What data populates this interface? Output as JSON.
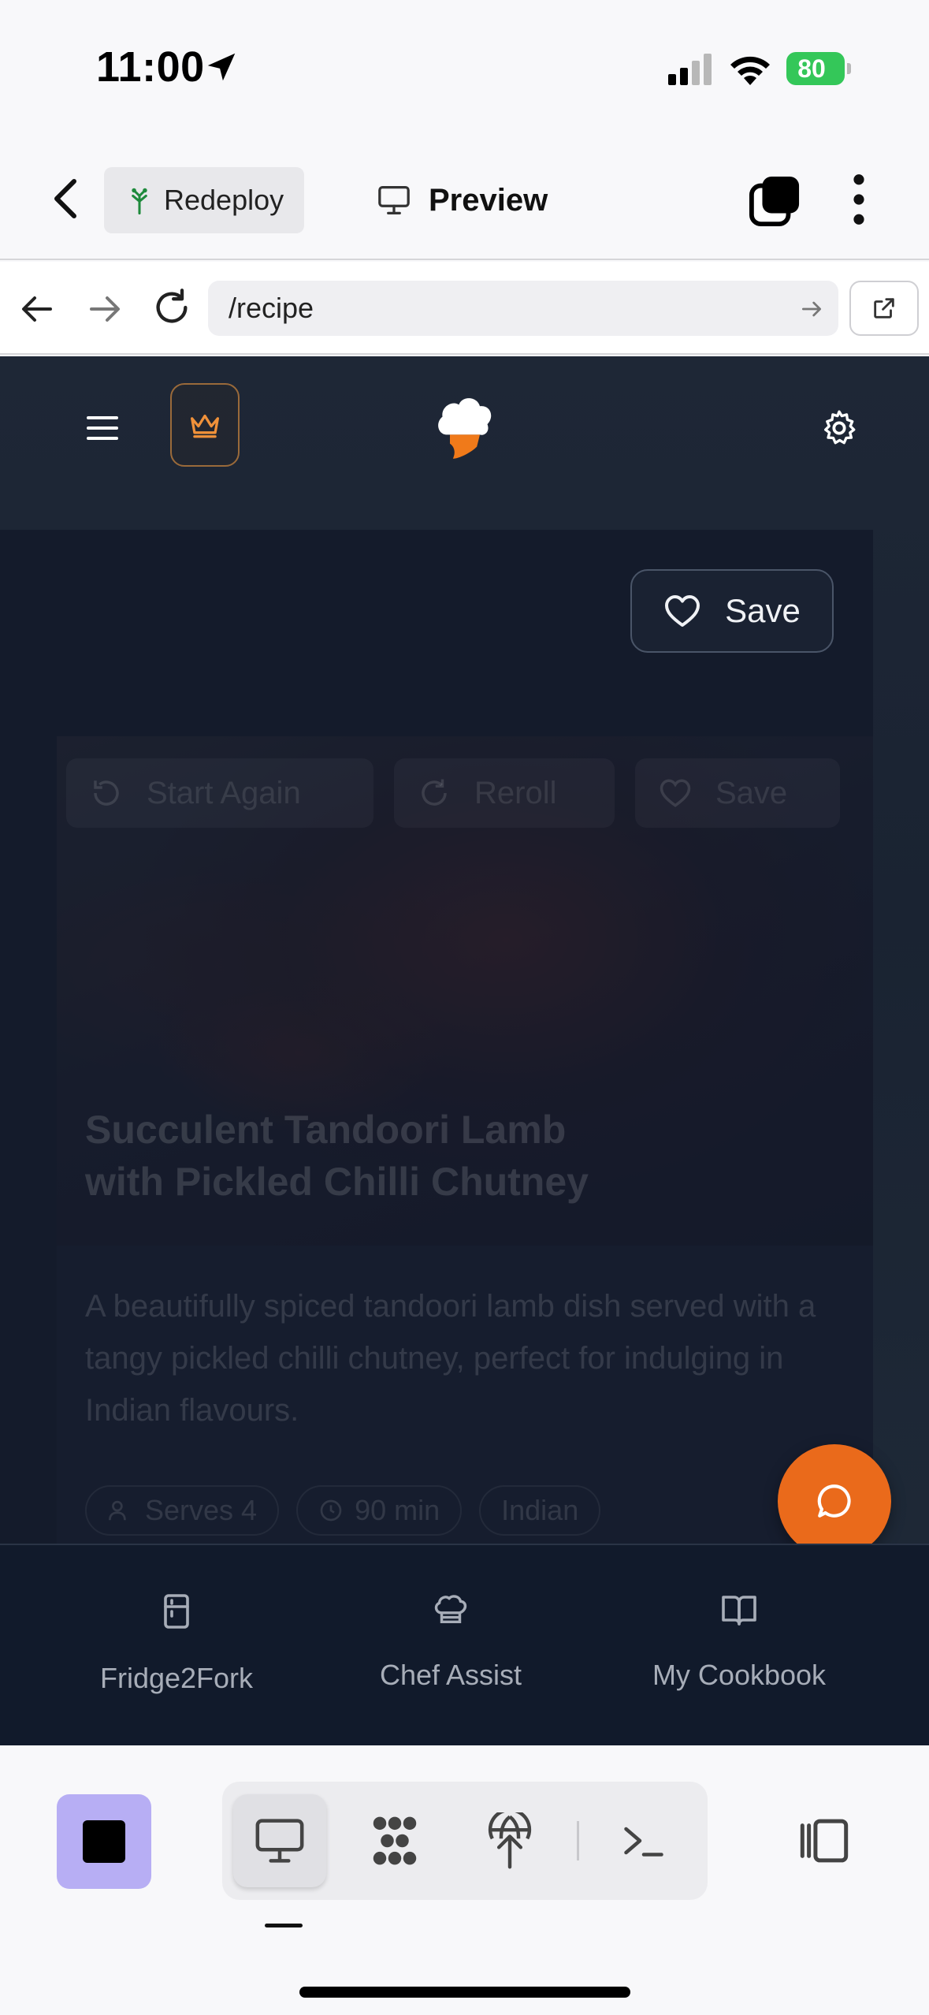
{
  "status_bar": {
    "time": "11:00",
    "battery": "80"
  },
  "toolbar": {
    "redeploy_label": "Redeploy",
    "preview_label": "Preview"
  },
  "browser": {
    "url": "/recipe"
  },
  "recipe": {
    "save_label": "Save",
    "image_buttons": {
      "start_again": "Start Again",
      "reroll": "Reroll",
      "save": "Save"
    },
    "title": "Succulent Tandoori Lamb with Pickled Chilli Chutney",
    "description": "A beautifully spiced tandoori lamb dish served with a tangy pickled chilli chutney, perfect for indulging in Indian flavours.",
    "chips": {
      "serves": "Serves 4",
      "time": "90 min",
      "cuisine": "Indian"
    }
  },
  "app_nav": {
    "items": [
      {
        "label": "Fridge2Fork",
        "icon": "fridge-icon"
      },
      {
        "label": "Chef Assist",
        "icon": "chef-hat-icon"
      },
      {
        "label": "My Cookbook",
        "icon": "book-icon"
      }
    ]
  },
  "colors": {
    "accent": "#ea6a1b",
    "stop_button": "#b7aef4",
    "battery": "#34c759",
    "app_bg": "#1a2332"
  }
}
